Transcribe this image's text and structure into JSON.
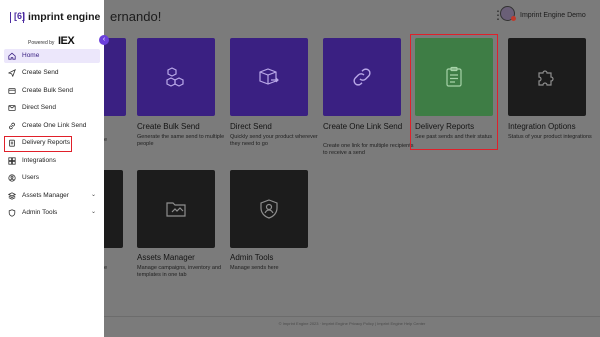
{
  "header": {
    "greeting_partial": "ernando!",
    "kebab_glyph": "⋮",
    "user_name": "Imprint Engine Demo"
  },
  "sidebar": {
    "brand_mark": "[6]",
    "brand_name": "imprint engine",
    "powered_by": "Powered by",
    "partner_logo": "IEX",
    "collapse_glyph": "‹",
    "items": [
      {
        "label": "Home",
        "icon": "home-icon",
        "active": true
      },
      {
        "label": "Create Send",
        "icon": "send-icon"
      },
      {
        "label": "Create Bulk Send",
        "icon": "bulk-send-icon"
      },
      {
        "label": "Direct Send",
        "icon": "direct-send-icon"
      },
      {
        "label": "Create One Link Send",
        "icon": "link-icon"
      },
      {
        "label": "Delivery Reports",
        "icon": "clipboard-icon",
        "highlighted": true
      },
      {
        "label": "Integrations",
        "icon": "integrations-icon"
      },
      {
        "label": "Users",
        "icon": "users-icon"
      },
      {
        "label": "Assets Manager",
        "icon": "assets-icon",
        "expandable": true
      },
      {
        "label": "Admin Tools",
        "icon": "shield-icon",
        "expandable": true
      }
    ],
    "chevron_glyph": "⌄"
  },
  "cards": [
    {
      "title": "Create Bulk Send",
      "desc": "Generate the same send to multiple people",
      "icon": "boxes-icon",
      "color": "#3a2082"
    },
    {
      "title": "Direct Send",
      "desc": "Quickly send your product wherever they need to go",
      "icon": "truck-box-icon",
      "color": "#3a2082"
    },
    {
      "title": "Create One Link Send",
      "desc": "Create one link for multiple recipients to receive a send",
      "icon": "link-icon",
      "color": "#3a2082"
    },
    {
      "title": "Delivery Reports",
      "desc": "See past sends and their status",
      "icon": "clipboard-icon",
      "color": "#3e7d45"
    },
    {
      "title": "Integration Options",
      "desc": "Status of your product integrations",
      "icon": "puzzle-icon",
      "color": "#1c1c1c"
    },
    {
      "title": "Assets Manager",
      "desc": "Manage campaigns, inventory and templates in one tab",
      "icon": "folder-icon",
      "color": "#1c1c1c"
    },
    {
      "title": "Admin Tools",
      "desc": "Manage sends here",
      "icon": "admin-shield-icon",
      "color": "#1c1c1c"
    }
  ],
  "partial_cards": {
    "row1_text": "e",
    "row2_text": "e"
  },
  "footer": {
    "text": "© Imprint Engine 2023 · Imprint Engine Privacy Policy | Imprint Engine Help Center"
  },
  "colors": {
    "accent": "#6b3fdc",
    "purple_card": "#3a2082",
    "green_card": "#3e7d45",
    "dark_card": "#1c1c1c",
    "highlight": "#e0202a"
  }
}
